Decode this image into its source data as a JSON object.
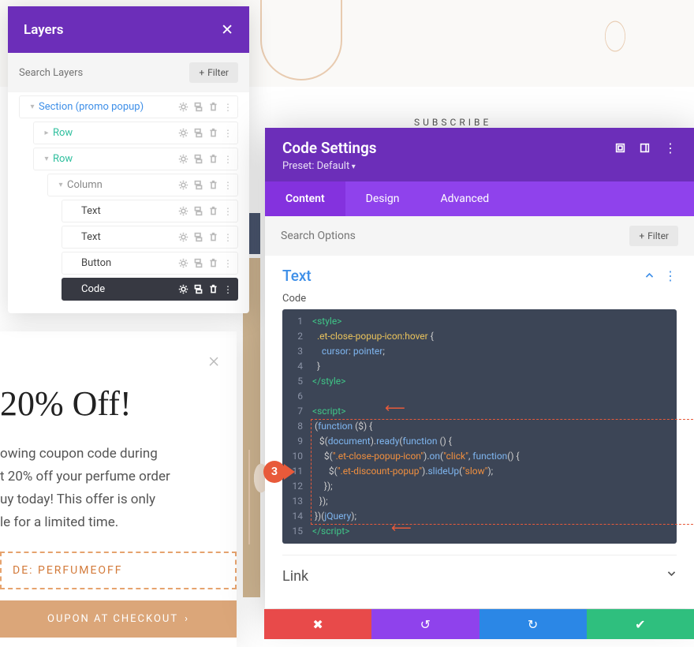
{
  "bg": {
    "subscribe": "SUBSCRIBE"
  },
  "layers": {
    "title": "Layers",
    "search_placeholder": "Search Layers",
    "filter": "Filter",
    "items": [
      {
        "label": "Section (promo popup)",
        "style": "blue",
        "indent": 0,
        "caret": "down"
      },
      {
        "label": "Row",
        "style": "teal",
        "indent": 1,
        "caret": "right"
      },
      {
        "label": "Row",
        "style": "teal",
        "indent": 1,
        "caret": "down"
      },
      {
        "label": "Column",
        "style": "grey",
        "indent": 2,
        "caret": "down"
      },
      {
        "label": "Text",
        "style": "dark",
        "indent": 3,
        "caret": ""
      },
      {
        "label": "Text",
        "style": "dark",
        "indent": 3,
        "caret": ""
      },
      {
        "label": "Button",
        "style": "dark",
        "indent": 3,
        "caret": ""
      },
      {
        "label": "Code",
        "style": "sel",
        "indent": 3,
        "caret": ""
      }
    ]
  },
  "promo": {
    "headline": " 20% Off!",
    "body_l1": "owing coupon code during",
    "body_l2": "t 20% off your perfume order",
    "body_l3": "uy today! This offer is only",
    "body_l4": "le for a limited time.",
    "coupon": "DE: PERFUMEOFF",
    "cta": "OUPON AT CHECKOUT"
  },
  "code_modal": {
    "title": "Code Settings",
    "preset": "Preset: Default",
    "tabs": [
      "Content",
      "Design",
      "Advanced"
    ],
    "search_placeholder": "Search Options",
    "filter": "Filter",
    "section_title": "Text",
    "code_label": "Code",
    "link_label": "Link",
    "annotation": "3",
    "code_lines": [
      {
        "n": 1,
        "html": "<span class='t-tag'>&lt;style&gt;</span>"
      },
      {
        "n": 2,
        "html": "  <span class='t-sel'>.et-close-popup-icon:hover</span> {"
      },
      {
        "n": 3,
        "html": "    <span class='t-prop'>cursor</span>: <span class='t-prop'>pointer</span>;"
      },
      {
        "n": 4,
        "html": "  }"
      },
      {
        "n": 5,
        "html": "<span class='t-tag'>&lt;/style&gt;</span>"
      },
      {
        "n": 6,
        "html": " "
      },
      {
        "n": 7,
        "html": "<span class='t-tag'>&lt;script&gt;</span>"
      },
      {
        "n": 8,
        "html": " (<span class='t-fn'>function</span> ($) {"
      },
      {
        "n": 9,
        "html": "   $(<span class='t-prop'>document</span>).<span class='t-prop'>ready</span>(<span class='t-fn'>function</span> () {"
      },
      {
        "n": 10,
        "html": "     $(<span class='t-str'>\".et-close-popup-icon\"</span>).<span class='t-prop'>on</span>(<span class='t-str'>\"click\"</span>, <span class='t-fn'>function</span>() {"
      },
      {
        "n": 11,
        "html": "       $(<span class='t-str'>\".et-discount-popup\"</span>).<span class='t-prop'>slideUp</span>(<span class='t-str'>\"slow\"</span>);"
      },
      {
        "n": 12,
        "html": "     });"
      },
      {
        "n": 13,
        "html": "   });"
      },
      {
        "n": 14,
        "html": " })(<span class='t-prop'>jQuery</span>);"
      },
      {
        "n": 15,
        "html": "<span class='t-tag'>&lt;/script&gt;</span>"
      }
    ]
  }
}
